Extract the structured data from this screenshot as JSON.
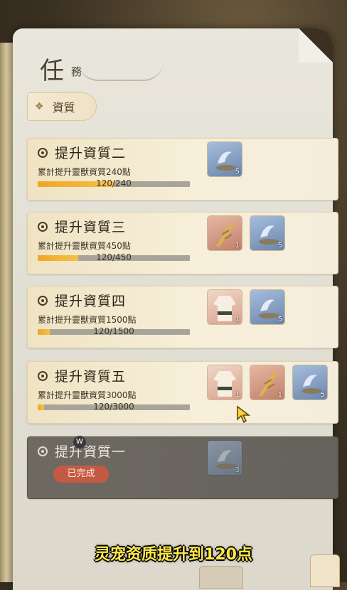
{
  "header": {
    "title_main": "任",
    "title_sub": "務"
  },
  "section": {
    "label": "資質"
  },
  "tasks": [
    {
      "title": "提升資質二",
      "desc": "累計提升靈獸資質240點",
      "progress_text": "120/240",
      "progress": 0.5,
      "rewards": [
        {
          "type": "blue",
          "qty": "5",
          "icon": "spirit-essence-icon"
        }
      ]
    },
    {
      "title": "提升資質三",
      "desc": "累計提升靈獸資質450點",
      "progress_text": "120/450",
      "progress": 0.267,
      "rewards": [
        {
          "type": "red",
          "qty": "1",
          "icon": "golden-herb-icon"
        },
        {
          "type": "blue",
          "qty": "5",
          "icon": "spirit-essence-icon"
        }
      ]
    },
    {
      "title": "提升資質四",
      "desc": "累計提升靈獸資質1500點",
      "progress_text": "120/1500",
      "progress": 0.08,
      "rewards": [
        {
          "type": "gown",
          "qty": "1",
          "icon": "costume-icon"
        },
        {
          "type": "blue",
          "qty": "5",
          "icon": "spirit-essence-icon"
        }
      ]
    },
    {
      "title": "提升資質五",
      "desc": "累計提升靈獸資質3000點",
      "progress_text": "120/3000",
      "progress": 0.04,
      "rewards": [
        {
          "type": "gown",
          "qty": "1",
          "icon": "costume-icon"
        },
        {
          "type": "red",
          "qty": "1",
          "icon": "golden-herb-icon"
        },
        {
          "type": "blue",
          "qty": "5",
          "icon": "spirit-essence-icon"
        }
      ]
    }
  ],
  "completed_task": {
    "title": "提升資質一",
    "status": "已完成",
    "w_badge": "W",
    "rewards": [
      {
        "type": "blue",
        "qty": "3",
        "icon": "spirit-essence-icon"
      }
    ]
  },
  "subtitle": "灵宠资质提升到120点",
  "colors": {
    "progress": "#f0a626",
    "completed_badge": "#c45a43",
    "subtitle": "#ffe94a"
  }
}
